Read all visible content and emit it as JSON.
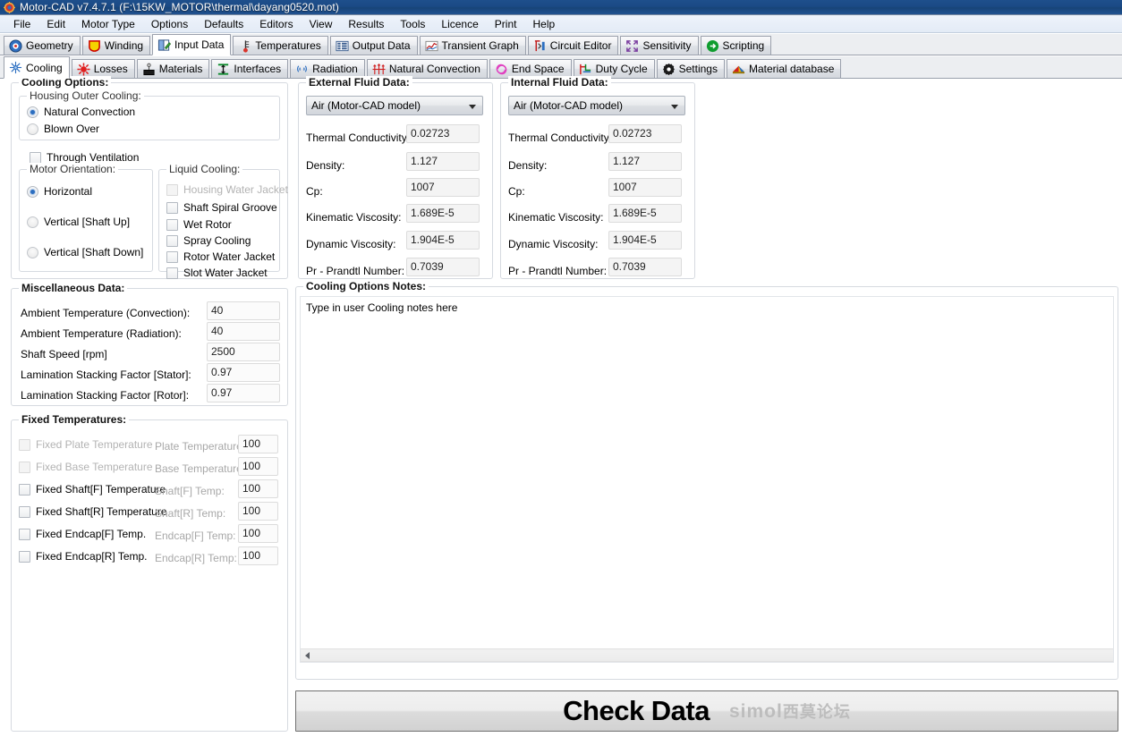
{
  "window": {
    "title": "Motor-CAD v7.4.7.1 (F:\\15KW_MOTOR\\thermal\\dayang0520.mot)",
    "app_icon": "motor-cad-icon"
  },
  "menu": {
    "items": [
      "File",
      "Edit",
      "Motor Type",
      "Options",
      "Defaults",
      "Editors",
      "View",
      "Results",
      "Tools",
      "Licence",
      "Print",
      "Help"
    ]
  },
  "primary_tabs": {
    "active": "Input Data",
    "items": [
      {
        "label": "Geometry",
        "icon": "geometry-icon"
      },
      {
        "label": "Winding",
        "icon": "winding-icon"
      },
      {
        "label": "Input Data",
        "icon": "input-data-icon"
      },
      {
        "label": "Temperatures",
        "icon": "thermometer-icon"
      },
      {
        "label": "Output Data",
        "icon": "output-data-icon"
      },
      {
        "label": "Transient Graph",
        "icon": "graph-icon"
      },
      {
        "label": "Circuit Editor",
        "icon": "circuit-icon"
      },
      {
        "label": "Sensitivity",
        "icon": "sensitivity-icon"
      },
      {
        "label": "Scripting",
        "icon": "scripting-icon"
      }
    ]
  },
  "secondary_tabs": {
    "active": "Cooling",
    "items": [
      {
        "label": "Cooling",
        "icon": "snowflake-icon"
      },
      {
        "label": "Losses",
        "icon": "sun-icon"
      },
      {
        "label": "Materials",
        "icon": "materials-icon"
      },
      {
        "label": "Interfaces",
        "icon": "interfaces-icon"
      },
      {
        "label": "Radiation",
        "icon": "radiation-icon"
      },
      {
        "label": "Natural Convection",
        "icon": "natural-convection-icon"
      },
      {
        "label": "End Space",
        "icon": "end-space-icon"
      },
      {
        "label": "Duty Cycle",
        "icon": "duty-cycle-icon"
      },
      {
        "label": "Settings",
        "icon": "gear-icon"
      },
      {
        "label": "Material database",
        "icon": "material-database-icon"
      }
    ]
  },
  "cooling_options": {
    "title": "Cooling Options:",
    "housing_outer_cooling": {
      "title": "Housing Outer Cooling:",
      "options": [
        {
          "label": "Natural Convection",
          "selected": true
        },
        {
          "label": "Blown Over",
          "selected": false
        }
      ]
    },
    "through_ventilation": {
      "label": "Through Ventilation",
      "checked": false
    },
    "motor_orientation": {
      "title": "Motor Orientation:",
      "options": [
        {
          "label": "Horizontal",
          "selected": true
        },
        {
          "label": "Vertical [Shaft Up]",
          "selected": false
        },
        {
          "label": "Vertical [Shaft Down]",
          "selected": false
        }
      ]
    },
    "liquid_cooling": {
      "title": "Liquid Cooling:",
      "options": [
        {
          "label": "Housing Water Jacket",
          "checked": false,
          "disabled": true
        },
        {
          "label": "Shaft Spiral Groove",
          "checked": false,
          "disabled": false
        },
        {
          "label": "Wet Rotor",
          "checked": false,
          "disabled": false
        },
        {
          "label": "Spray Cooling",
          "checked": false,
          "disabled": false
        },
        {
          "label": "Rotor Water Jacket",
          "checked": false,
          "disabled": false
        },
        {
          "label": "Slot Water Jacket",
          "checked": false,
          "disabled": false
        }
      ]
    }
  },
  "external_fluid": {
    "title": "External Fluid Data:",
    "fluid_selected": "Air (Motor-CAD model)",
    "fields": [
      {
        "label": "Thermal Conductivity:",
        "value": "0.02723"
      },
      {
        "label": "Density:",
        "value": "1.127"
      },
      {
        "label": "Cp:",
        "value": "1007"
      },
      {
        "label": "Kinematic Viscosity:",
        "value": "1.689E-5"
      },
      {
        "label": "Dynamic Viscosity:",
        "value": "1.904E-5"
      },
      {
        "label": "Pr - Prandtl Number:",
        "value": "0.7039"
      }
    ]
  },
  "internal_fluid": {
    "title": "Internal Fluid Data:",
    "fluid_selected": "Air (Motor-CAD model)",
    "fields": [
      {
        "label": "Thermal Conductivity:",
        "value": "0.02723"
      },
      {
        "label": "Density:",
        "value": "1.127"
      },
      {
        "label": "Cp:",
        "value": "1007"
      },
      {
        "label": "Kinematic Viscosity:",
        "value": "1.689E-5"
      },
      {
        "label": "Dynamic Viscosity:",
        "value": "1.904E-5"
      },
      {
        "label": "Pr - Prandtl Number:",
        "value": "0.7039"
      }
    ]
  },
  "miscellaneous": {
    "title": "Miscellaneous Data:",
    "fields": [
      {
        "label": "Ambient Temperature (Convection):",
        "value": "40"
      },
      {
        "label": "Ambient Temperature (Radiation):",
        "value": "40"
      },
      {
        "label": "Shaft Speed [rpm]",
        "value": "2500"
      },
      {
        "label": "Lamination Stacking Factor [Stator]:",
        "value": "0.97"
      },
      {
        "label": "Lamination Stacking Factor [Rotor]:",
        "value": "0.97"
      }
    ]
  },
  "fixed_temperatures": {
    "title": "Fixed Temperatures:",
    "rows": [
      {
        "check_label": "Fixed Plate Temperature",
        "checked": false,
        "check_disabled": true,
        "field_label": "Plate Temperature:",
        "value": "100"
      },
      {
        "check_label": "Fixed Base Temperature",
        "checked": false,
        "check_disabled": true,
        "field_label": "Base Temperature:",
        "value": "100"
      },
      {
        "check_label": "Fixed Shaft[F] Temperature",
        "checked": false,
        "check_disabled": false,
        "field_label": "Shaft[F] Temp:",
        "value": "100"
      },
      {
        "check_label": "Fixed Shaft[R] Temperature",
        "checked": false,
        "check_disabled": false,
        "field_label": "Shaft[R] Temp:",
        "value": "100"
      },
      {
        "check_label": "Fixed Endcap[F] Temp.",
        "checked": false,
        "check_disabled": false,
        "field_label": "Endcap[F] Temp:",
        "value": "100"
      },
      {
        "check_label": "Fixed Endcap[R] Temp.",
        "checked": false,
        "check_disabled": false,
        "field_label": "Endcap[R] Temp:",
        "value": "100"
      }
    ]
  },
  "cooling_notes": {
    "title": "Cooling Options Notes:",
    "text": "Type in user Cooling notes here",
    "scroll_left_icon": "arrow-left-icon"
  },
  "check_data": {
    "label": "Check Data",
    "watermark_latin": "simol",
    "watermark_cn": "西莫论坛"
  },
  "colors": {
    "titlebar": "#1b4a85",
    "accent_blue": "#2b6ec0",
    "panel_bg": "#ffffff",
    "tabstrip_bg": "#eceef1",
    "field_bg": "#f4f4f4"
  }
}
